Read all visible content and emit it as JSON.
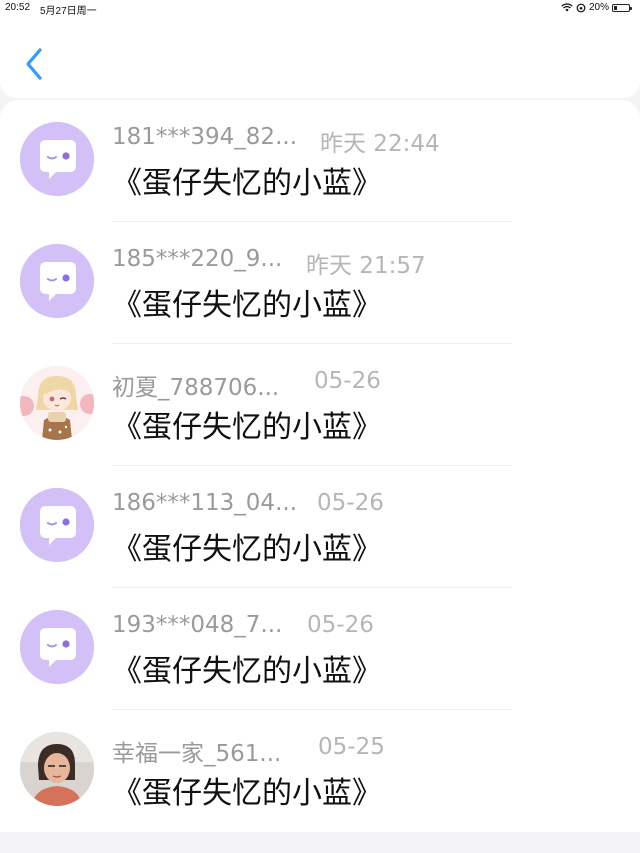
{
  "status": {
    "time": "20:52",
    "date": "5月27日周一",
    "battery": "20%",
    "battery_level": 0.2
  },
  "header": {
    "back_icon": "chevron-left-icon"
  },
  "colors": {
    "accent": "#2f9bff",
    "bot_avatar_bg": "#d3c0f7"
  },
  "messages": [
    {
      "name": "181***394_82...",
      "time": "昨天 22:44",
      "text": "《蛋仔失忆的小蓝》",
      "avatar": "bot-avatar"
    },
    {
      "name": "185***220_9...",
      "time": "昨天 21:57",
      "text": "《蛋仔失忆的小蓝》",
      "avatar": "bot-avatar"
    },
    {
      "name": "初夏_788706...",
      "time": "05-26",
      "text": "《蛋仔失忆的小蓝》",
      "avatar": "anime-girl-avatar"
    },
    {
      "name": "186***113_04...",
      "time": "05-26",
      "text": "《蛋仔失忆的小蓝》",
      "avatar": "bot-avatar"
    },
    {
      "name": "193***048_7...",
      "time": "05-26",
      "text": "《蛋仔失忆的小蓝》",
      "avatar": "bot-avatar"
    },
    {
      "name": "幸福一家_561...",
      "time": "05-25",
      "text": "《蛋仔失忆的小蓝》",
      "avatar": "photo-avatar"
    }
  ]
}
